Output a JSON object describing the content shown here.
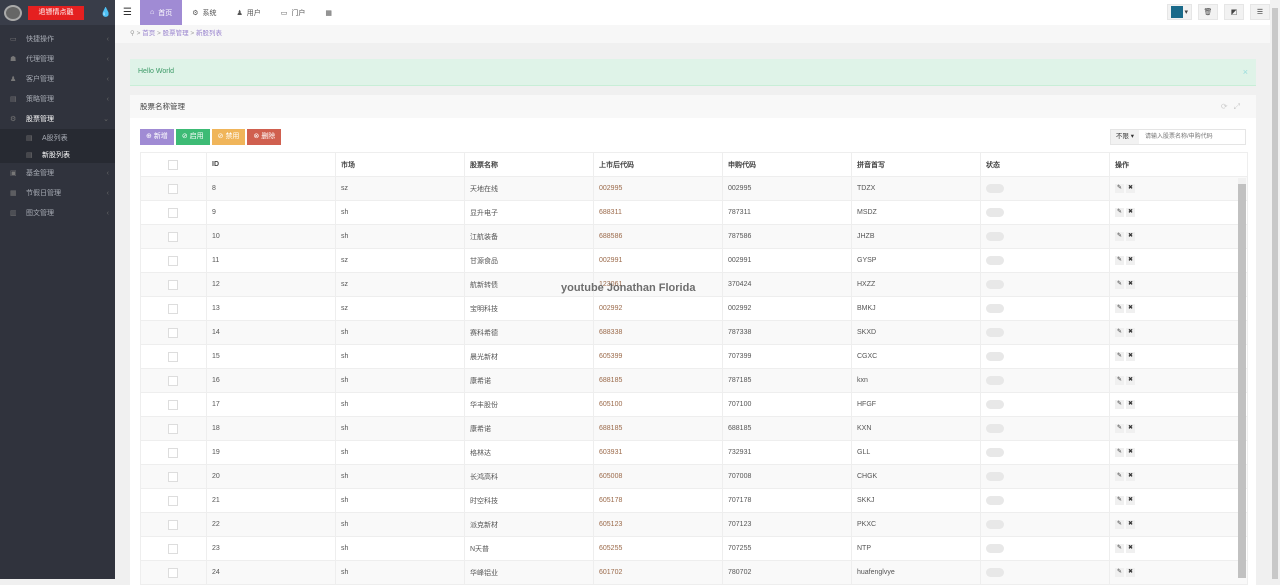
{
  "brand": "退镖情点融",
  "sidebar": [
    {
      "label": "快捷操作",
      "icon": "folder-icon"
    },
    {
      "label": "代理管理",
      "icon": "group-icon"
    },
    {
      "label": "客户管理",
      "icon": "user-icon"
    },
    {
      "label": "策略管理",
      "icon": "list-icon"
    },
    {
      "label": "股票管理",
      "icon": "cogs-icon",
      "active": true
    },
    {
      "label": "基金管理",
      "icon": "money-icon"
    },
    {
      "label": "节假日管理",
      "icon": "calendar-icon"
    },
    {
      "label": "图文管理",
      "icon": "book-icon"
    }
  ],
  "submenu": [
    {
      "label": "A股列表"
    },
    {
      "label": "新股列表"
    }
  ],
  "topnav": [
    {
      "label": "首页",
      "icon": "home-icon"
    },
    {
      "label": "系统",
      "icon": "gear-icon"
    },
    {
      "label": "用户",
      "icon": "user-icon"
    },
    {
      "label": "门户",
      "icon": "portal-icon"
    }
  ],
  "breadcrumb": [
    "首页",
    "股票管理",
    "新股列表"
  ],
  "alert": "Hello World",
  "panel_title": "股票名称管理",
  "buttons": {
    "add": "新增",
    "enable": "启用",
    "disable": "禁用",
    "delete": "删除"
  },
  "filter": {
    "selected": "不限",
    "placeholder": "请输入股票名称/申购代码"
  },
  "columns": [
    "ID",
    "市场",
    "股票名称",
    "上市后代码",
    "申购代码",
    "拼音首写",
    "状态",
    "操作"
  ],
  "rows": [
    [
      "8",
      "sz",
      "天地在线",
      "002995",
      "002995",
      "TDZX"
    ],
    [
      "9",
      "sh",
      "显升电子",
      "688311",
      "787311",
      "MSDZ"
    ],
    [
      "10",
      "sh",
      "江航装备",
      "688586",
      "787586",
      "JHZB"
    ],
    [
      "11",
      "sz",
      "甘源食品",
      "002991",
      "002991",
      "GYSP"
    ],
    [
      "12",
      "sz",
      "航新转债",
      "123061",
      "370424",
      "HXZZ"
    ],
    [
      "13",
      "sz",
      "宝明科技",
      "002992",
      "002992",
      "BMKJ"
    ],
    [
      "14",
      "sh",
      "赛科希德",
      "688338",
      "787338",
      "SKXD"
    ],
    [
      "15",
      "sh",
      "晨光新材",
      "605399",
      "707399",
      "CGXC"
    ],
    [
      "16",
      "sh",
      "康希诺",
      "688185",
      "787185",
      "kxn"
    ],
    [
      "17",
      "sh",
      "华丰股份",
      "605100",
      "707100",
      "HFGF"
    ],
    [
      "18",
      "sh",
      "康希诺",
      "688185",
      "688185",
      "KXN"
    ],
    [
      "19",
      "sh",
      "格林达",
      "603931",
      "732931",
      "GLL"
    ],
    [
      "20",
      "sh",
      "长鸿高科",
      "605008",
      "707008",
      "CHGK"
    ],
    [
      "21",
      "sh",
      "时空科技",
      "605178",
      "707178",
      "SKKJ"
    ],
    [
      "22",
      "sh",
      "派克新材",
      "605123",
      "707123",
      "PKXC"
    ],
    [
      "23",
      "sh",
      "N天普",
      "605255",
      "707255",
      "NTP"
    ],
    [
      "24",
      "sh",
      "华峰铝业",
      "601702",
      "780702",
      "huafenglvye"
    ]
  ],
  "watermark": "youtube Jonathan Florida",
  "colors": {
    "sidebar": "#30333d",
    "accent": "#a08bd4",
    "green": "#3dbb75",
    "orange": "#f0b55a",
    "red": "#d0604f"
  }
}
